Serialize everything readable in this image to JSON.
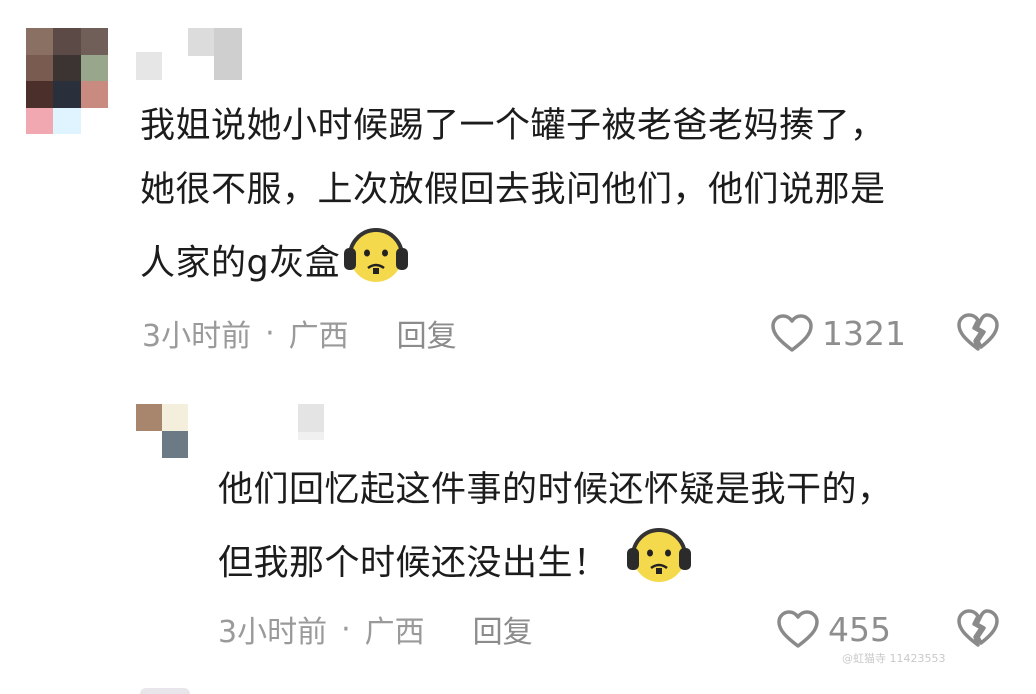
{
  "comments": [
    {
      "text_lines": [
        "我姐说她小时候踢了一个罐子被老爸老妈揍了，",
        "她很不服，上次放假回去我问他们，他们说那是",
        "人家的g灰盒"
      ],
      "emoji": "headphones-frown-emoji",
      "time": "3小时前",
      "separator": "·",
      "location": "广西",
      "reply_label": "回复",
      "likes": "1321",
      "avatar_colors": [
        "#8a6f63",
        "#5b4a45",
        "#6f5f58",
        "#7a5b4f",
        "#3c3433",
        "#98a78c",
        "#4a2f2a",
        "#2a2f3c",
        "#c98a80",
        "#f2a8b0",
        "#dff4ff",
        "#ffffff"
      ],
      "name_colors": [
        "#e6e6e6",
        "#ffffff",
        "#d6d6d6",
        "#cfcfcf"
      ]
    },
    {
      "text_lines": [
        "他们回忆起这件事的时候还怀疑是我干的，",
        "但我那个时候还没出生！"
      ],
      "emoji": "headphones-frown-emoji",
      "time": "3小时前",
      "separator": "·",
      "location": "广西",
      "reply_label": "回复",
      "likes": "455",
      "avatar_colors": [
        "#a8866e",
        "#f4efdc",
        "#ffffff",
        "#6c7a86"
      ],
      "name_colors": [
        "#e4e4e4",
        "#f0f0f0"
      ]
    }
  ],
  "icons": {
    "like": "heart-outline-icon",
    "dislike": "broken-heart-icon"
  },
  "watermark": "@虹猫寺 11423553"
}
